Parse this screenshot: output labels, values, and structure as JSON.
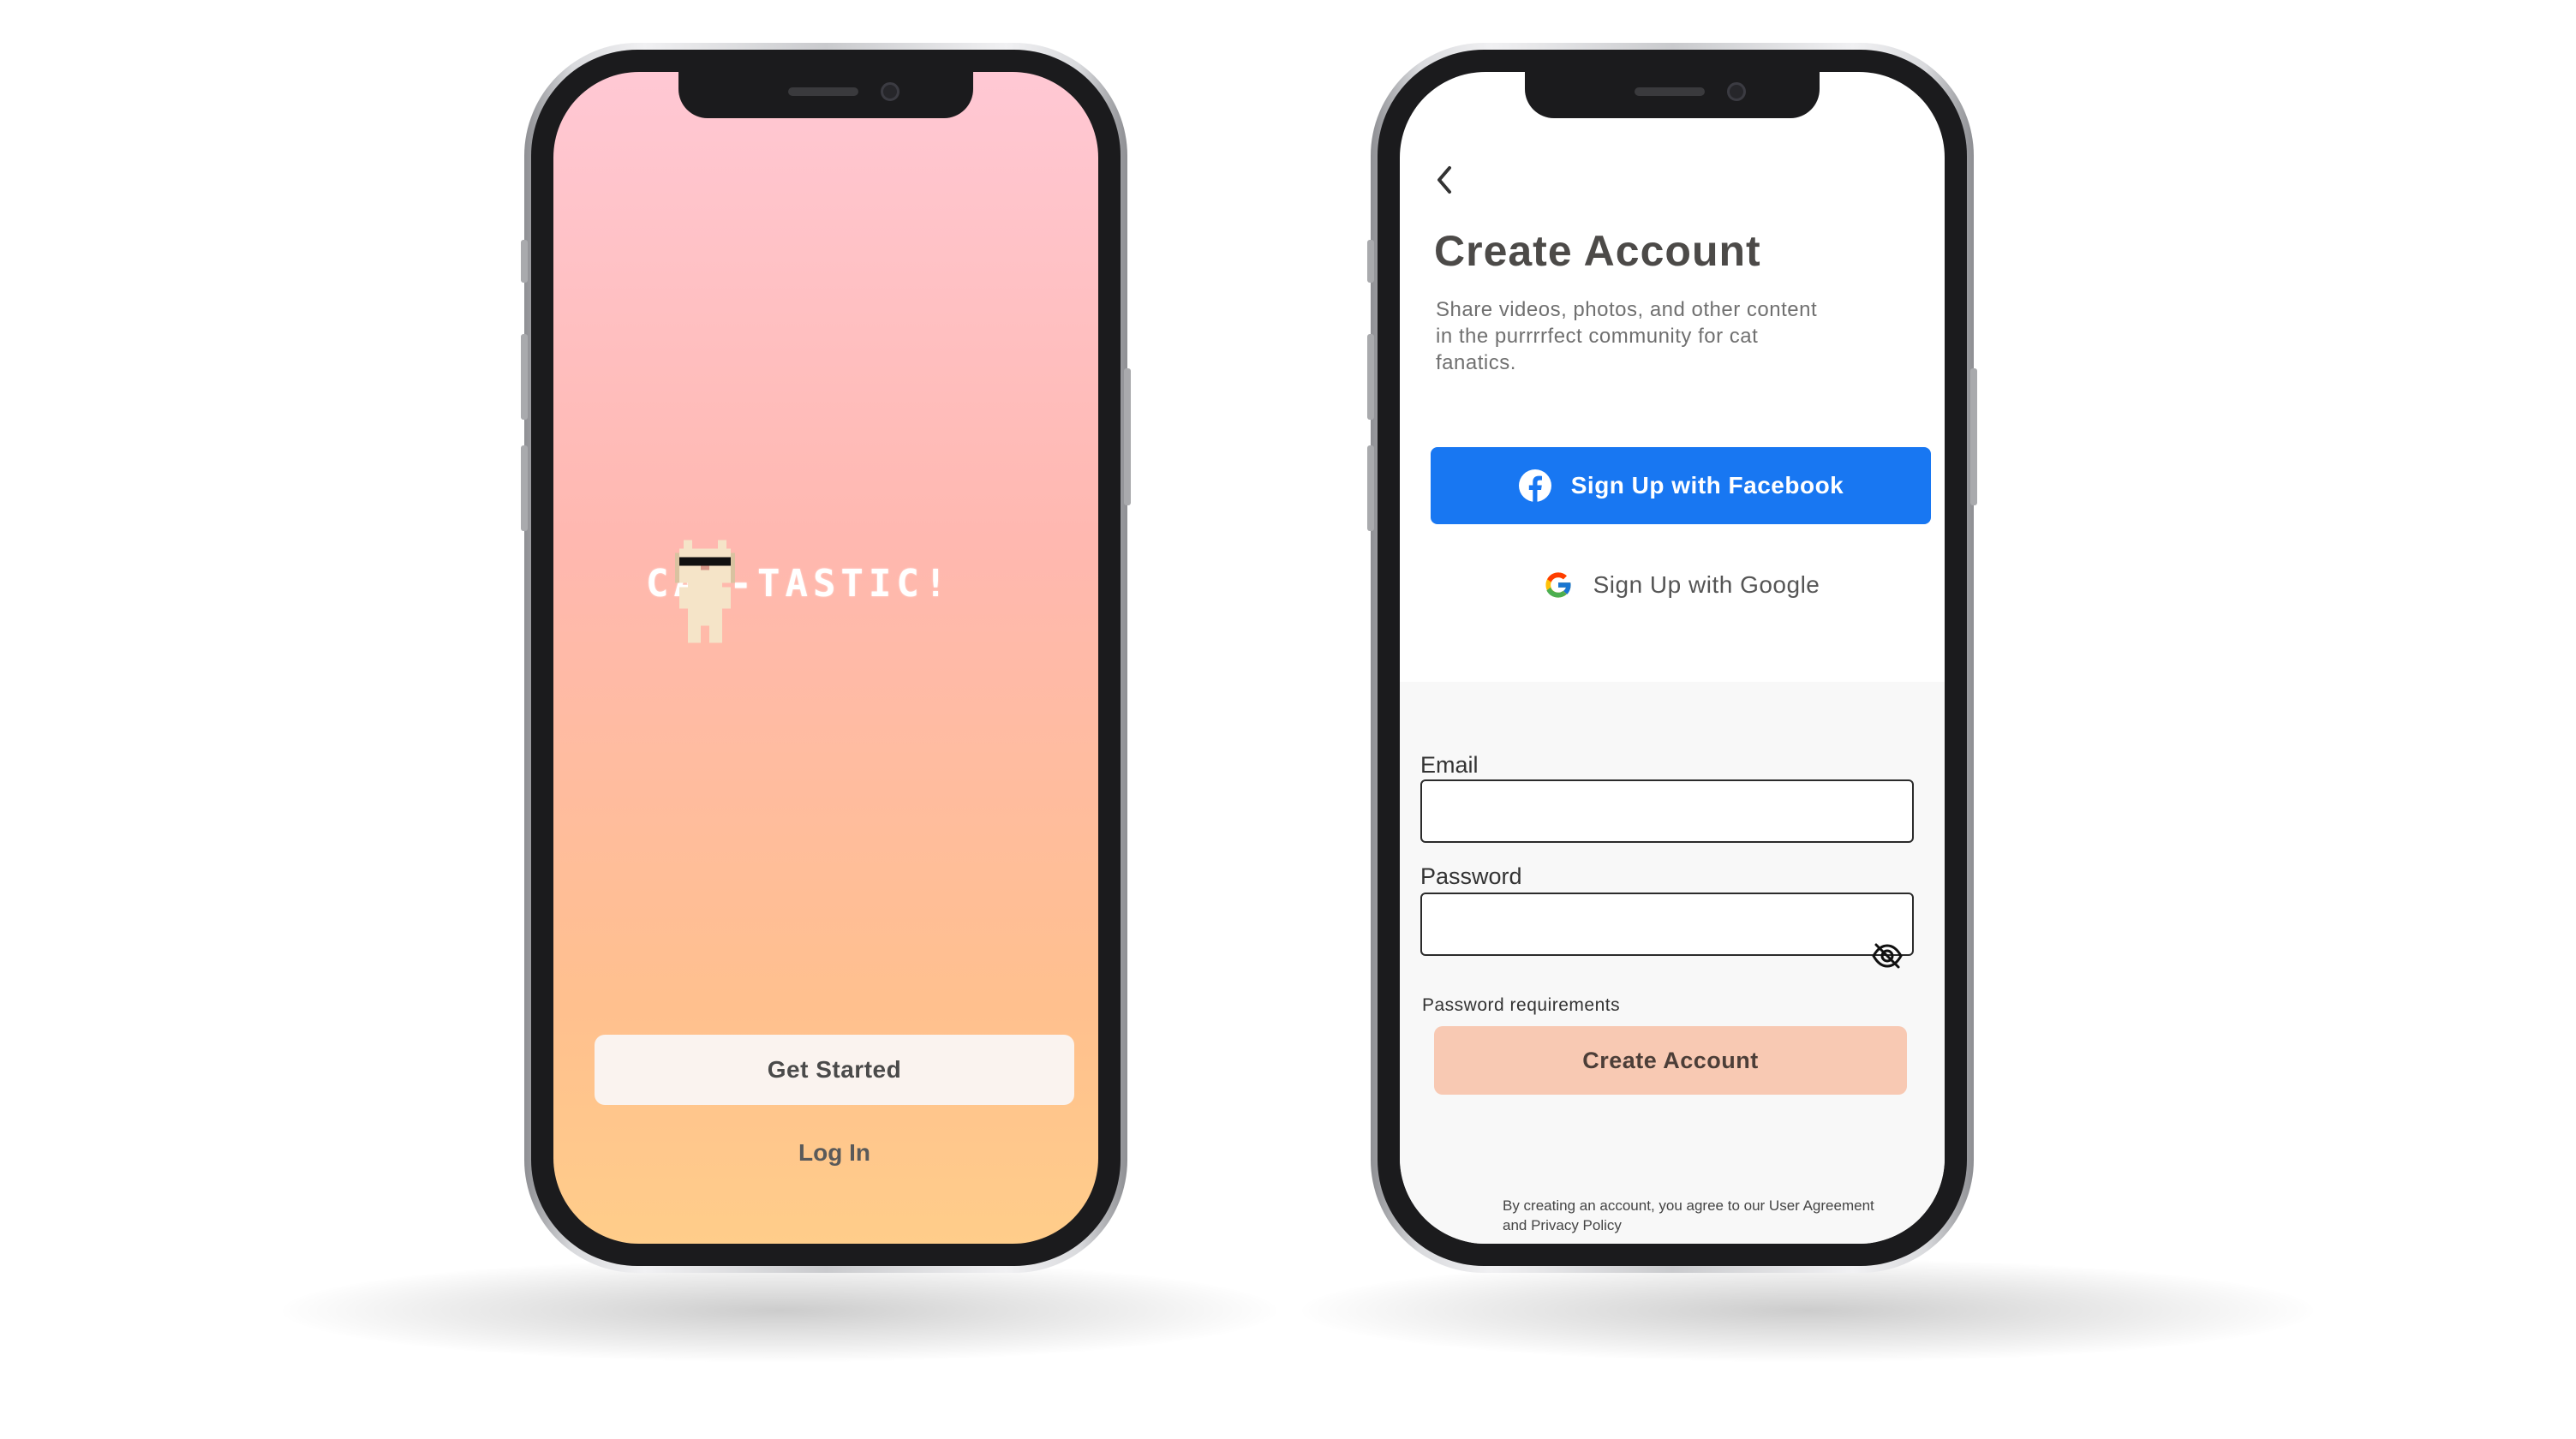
{
  "splash": {
    "logo_text": "CAT-TASTIC!",
    "get_started_label": "Get Started",
    "login_label": "Log In"
  },
  "signup": {
    "title": "Create Account",
    "subtitle": "Share videos, photos, and other content in the purrrrfect community for cat fanatics.",
    "facebook_label": "Sign Up with Facebook",
    "google_label": "Sign Up with Google",
    "email_label": "Email",
    "email_value": "",
    "password_label": "Password",
    "password_value": "",
    "password_requirements": "Password requirements",
    "create_label": "Create Account",
    "terms": "By creating an account, you agree to our User Agreement and Privacy Policy"
  },
  "colors": {
    "facebook_blue": "#1877f2",
    "create_button": "#f8c9b3",
    "splash_top": "#ffc8d4",
    "splash_bottom": "#ffcd8a"
  },
  "icons": [
    "cat-mascot-icon",
    "back-chevron-icon",
    "facebook-icon",
    "google-icon",
    "eye-off-icon"
  ]
}
